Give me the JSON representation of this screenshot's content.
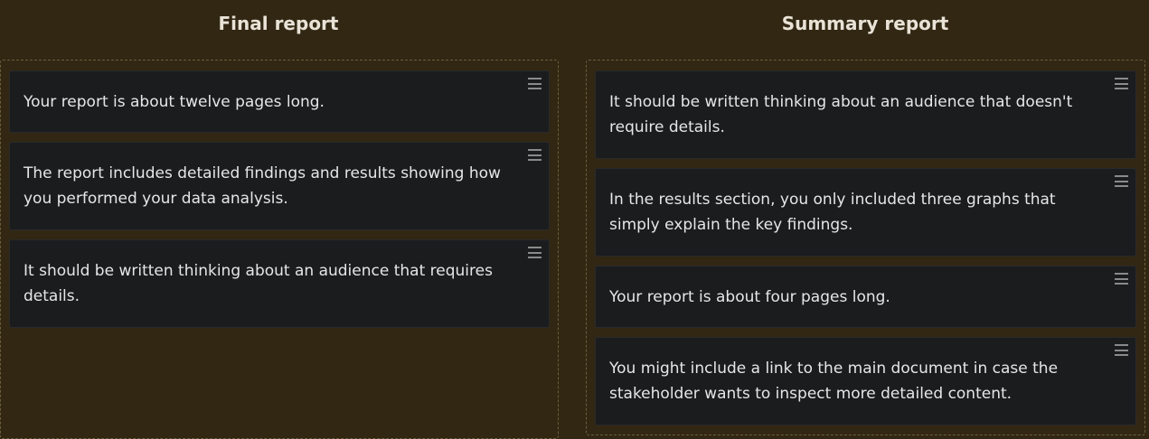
{
  "columns": [
    {
      "title": "Final report",
      "cards": [
        "Your report is about twelve pages long.",
        "The report includes detailed findings and results showing how you performed your data analysis.",
        "It should be written thinking about an audience that requires details."
      ]
    },
    {
      "title": "Summary report",
      "cards": [
        "It should be written thinking about an audience that doesn't require details.",
        "In the results section, you only included three graphs that simply explain the key findings.",
        "Your report is about four pages long.",
        "You might include a link to the main document in case the stakeholder wants to inspect more detailed content."
      ]
    }
  ],
  "icons": {
    "drag_handle": "drag-handle-icon"
  }
}
